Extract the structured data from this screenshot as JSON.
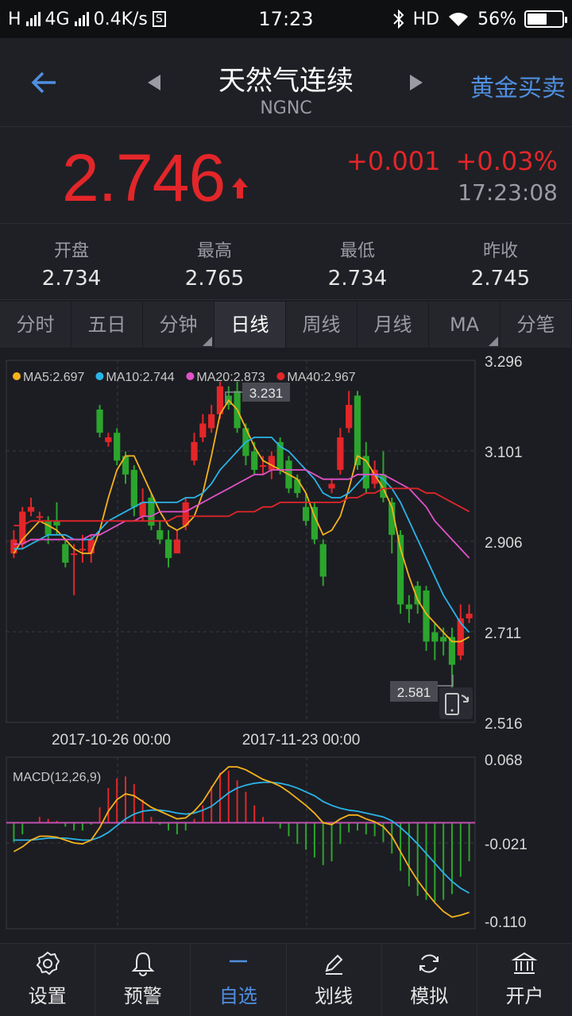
{
  "status_bar": {
    "carrier": "H",
    "network": "4G",
    "speed": "0.4K/s",
    "s_badge": "S",
    "time": "17:23",
    "bluetooth_icon": "bluetooth-icon",
    "hd": "HD",
    "wifi_icon": "wifi-icon",
    "battery": "56%",
    "battery_level": 0.56
  },
  "header": {
    "title": "天然气连续",
    "code": "NGNC",
    "right_link": "黄金买卖"
  },
  "quote": {
    "price": "2.746",
    "change": "+0.001",
    "change_pct": "+0.03%",
    "time": "17:23:08"
  },
  "stats": [
    {
      "label": "开盘",
      "value": "2.734"
    },
    {
      "label": "最高",
      "value": "2.765"
    },
    {
      "label": "最低",
      "value": "2.734"
    },
    {
      "label": "昨收",
      "value": "2.745"
    }
  ],
  "tabs": [
    {
      "label": "分时",
      "active": false,
      "dropdown": false
    },
    {
      "label": "五日",
      "active": false,
      "dropdown": false
    },
    {
      "label": "分钟",
      "active": false,
      "dropdown": true
    },
    {
      "label": "日线",
      "active": true,
      "dropdown": false
    },
    {
      "label": "周线",
      "active": false,
      "dropdown": false
    },
    {
      "label": "月线",
      "active": false,
      "dropdown": false
    },
    {
      "label": "MA",
      "active": false,
      "dropdown": true
    },
    {
      "label": "分笔",
      "active": false,
      "dropdown": false
    }
  ],
  "chart_data": [
    {
      "type": "candlestick",
      "ma_legend": [
        {
          "label": "MA5:2.697",
          "color": "#f5b21c"
        },
        {
          "label": "MA10:2.744",
          "color": "#2ab4e8"
        },
        {
          "label": "MA20:2.873",
          "color": "#e052c8"
        },
        {
          "label": "MA40:2.967",
          "color": "#e3262a"
        }
      ],
      "y_ticks": [
        "3.296",
        "3.101",
        "2.906",
        "2.711",
        "2.516"
      ],
      "ylim": [
        2.516,
        3.296
      ],
      "x_ticks": [
        "2017-10-26 00:00",
        "2017-11-23 00:00"
      ],
      "max_label": "3.231",
      "min_label": "2.581",
      "candles": [
        {
          "o": 2.88,
          "c": 2.91,
          "h": 2.93,
          "l": 2.87
        },
        {
          "o": 2.9,
          "c": 2.97,
          "h": 2.98,
          "l": 2.89
        },
        {
          "o": 2.97,
          "c": 2.98,
          "h": 3.0,
          "l": 2.96
        },
        {
          "o": 2.96,
          "c": 2.96,
          "h": 2.97,
          "l": 2.95
        },
        {
          "o": 2.95,
          "c": 2.92,
          "h": 2.96,
          "l": 2.9
        },
        {
          "o": 2.95,
          "c": 2.94,
          "h": 2.99,
          "l": 2.92
        },
        {
          "o": 2.9,
          "c": 2.86,
          "h": 2.91,
          "l": 2.85
        },
        {
          "o": 2.88,
          "c": 2.88,
          "h": 2.9,
          "l": 2.79
        },
        {
          "o": 2.89,
          "c": 2.89,
          "h": 2.92,
          "l": 2.86
        },
        {
          "o": 2.88,
          "c": 2.91,
          "h": 2.92,
          "l": 2.86
        },
        {
          "o": 3.19,
          "c": 3.14,
          "h": 3.2,
          "l": 3.13
        },
        {
          "o": 3.12,
          "c": 3.13,
          "h": 3.14,
          "l": 3.11
        },
        {
          "o": 3.14,
          "c": 3.08,
          "h": 3.15,
          "l": 3.07
        },
        {
          "o": 3.09,
          "c": 3.05,
          "h": 3.1,
          "l": 3.03
        },
        {
          "o": 3.06,
          "c": 2.98,
          "h": 3.07,
          "l": 2.96
        },
        {
          "o": 2.96,
          "c": 2.99,
          "h": 3.02,
          "l": 2.95
        },
        {
          "o": 3.0,
          "c": 2.94,
          "h": 3.01,
          "l": 2.93
        },
        {
          "o": 2.93,
          "c": 2.91,
          "h": 2.95,
          "l": 2.9
        },
        {
          "o": 2.91,
          "c": 2.87,
          "h": 2.93,
          "l": 2.85
        },
        {
          "o": 2.88,
          "c": 2.91,
          "h": 2.93,
          "l": 2.89
        },
        {
          "o": 2.94,
          "c": 2.99,
          "h": 3.0,
          "l": 2.93
        },
        {
          "o": 3.08,
          "c": 3.12,
          "h": 3.14,
          "l": 3.07
        },
        {
          "o": 3.13,
          "c": 3.16,
          "h": 3.18,
          "l": 3.12
        },
        {
          "o": 3.15,
          "c": 3.18,
          "h": 3.2,
          "l": 3.14
        },
        {
          "o": 3.18,
          "c": 3.24,
          "h": 3.25,
          "l": 3.17
        },
        {
          "o": 3.22,
          "c": 3.2,
          "h": 3.24,
          "l": 3.19
        },
        {
          "o": 3.23,
          "c": 3.15,
          "h": 3.25,
          "l": 3.14
        },
        {
          "o": 3.15,
          "c": 3.09,
          "h": 3.16,
          "l": 3.07
        },
        {
          "o": 3.1,
          "c": 3.06,
          "h": 3.12,
          "l": 3.05
        },
        {
          "o": 3.07,
          "c": 3.07,
          "h": 3.09,
          "l": 3.05
        },
        {
          "o": 3.06,
          "c": 3.09,
          "h": 3.1,
          "l": 3.04
        },
        {
          "o": 3.12,
          "c": 3.06,
          "h": 3.13,
          "l": 3.05
        },
        {
          "o": 3.08,
          "c": 3.02,
          "h": 3.09,
          "l": 3.01
        },
        {
          "o": 3.04,
          "c": 3.01,
          "h": 3.05,
          "l": 3.0
        },
        {
          "o": 2.98,
          "c": 2.95,
          "h": 3.01,
          "l": 2.94
        },
        {
          "o": 2.98,
          "c": 2.91,
          "h": 2.99,
          "l": 2.9
        },
        {
          "o": 2.9,
          "c": 2.83,
          "h": 2.91,
          "l": 2.81
        },
        {
          "o": 3.02,
          "c": 3.03,
          "h": 3.04,
          "l": 3.01
        },
        {
          "o": 3.06,
          "c": 3.13,
          "h": 3.15,
          "l": 3.05
        },
        {
          "o": 3.15,
          "c": 3.2,
          "h": 3.23,
          "l": 3.14
        },
        {
          "o": 3.22,
          "c": 3.07,
          "h": 3.23,
          "l": 3.06
        },
        {
          "o": 3.09,
          "c": 3.02,
          "h": 3.12,
          "l": 3.01
        },
        {
          "o": 3.03,
          "c": 3.06,
          "h": 3.08,
          "l": 3.02
        },
        {
          "o": 3.05,
          "c": 3.0,
          "h": 3.1,
          "l": 2.99
        },
        {
          "o": 2.99,
          "c": 2.92,
          "h": 3.0,
          "l": 2.88
        },
        {
          "o": 2.92,
          "c": 2.77,
          "h": 2.93,
          "l": 2.75
        },
        {
          "o": 2.77,
          "c": 2.76,
          "h": 2.79,
          "l": 2.73
        },
        {
          "o": 2.81,
          "c": 2.77,
          "h": 2.82,
          "l": 2.75
        },
        {
          "o": 2.8,
          "c": 2.69,
          "h": 2.81,
          "l": 2.67
        },
        {
          "o": 2.71,
          "c": 2.69,
          "h": 2.73,
          "l": 2.65
        },
        {
          "o": 2.7,
          "c": 2.69,
          "h": 2.72,
          "l": 2.66
        },
        {
          "o": 2.7,
          "c": 2.64,
          "h": 2.72,
          "l": 2.58
        },
        {
          "o": 2.66,
          "c": 2.74,
          "h": 2.77,
          "l": 2.65
        },
        {
          "o": 2.74,
          "c": 2.75,
          "h": 2.77,
          "l": 2.73
        }
      ],
      "ma_series": [
        {
          "name": "MA5",
          "color": "#f5b21c",
          "values": [
            2.88,
            2.91,
            2.93,
            2.95,
            2.94,
            2.93,
            2.91,
            2.89,
            2.88,
            2.88,
            2.93,
            3.0,
            3.06,
            3.09,
            3.09,
            3.05,
            3.01,
            2.97,
            2.94,
            2.93,
            2.94,
            2.96,
            3.01,
            3.09,
            3.18,
            3.21,
            3.19,
            3.15,
            3.11,
            3.08,
            3.07,
            3.06,
            3.05,
            3.04,
            3.01,
            2.96,
            2.92,
            2.93,
            2.96,
            3.02,
            3.09,
            3.08,
            3.05,
            3.02,
            2.98,
            2.89,
            2.83,
            2.78,
            2.75,
            2.73,
            2.71,
            2.69,
            2.69,
            2.7
          ]
        },
        {
          "name": "MA10",
          "color": "#2ab4e8",
          "values": [
            2.89,
            2.89,
            2.9,
            2.91,
            2.92,
            2.92,
            2.92,
            2.91,
            2.91,
            2.91,
            2.93,
            2.95,
            2.96,
            2.97,
            2.98,
            2.99,
            2.99,
            2.99,
            2.99,
            2.99,
            3.0,
            3.0,
            3.01,
            3.03,
            3.06,
            3.08,
            3.1,
            3.12,
            3.13,
            3.13,
            3.13,
            3.11,
            3.1,
            3.08,
            3.06,
            3.04,
            3.01,
            3.0,
            3.0,
            3.01,
            3.03,
            3.05,
            3.05,
            3.04,
            3.02,
            2.99,
            2.95,
            2.91,
            2.87,
            2.83,
            2.79,
            2.76,
            2.73,
            2.71
          ]
        },
        {
          "name": "MA20",
          "color": "#e052c8",
          "values": [
            2.9,
            2.9,
            2.91,
            2.91,
            2.91,
            2.91,
            2.91,
            2.91,
            2.91,
            2.92,
            2.92,
            2.93,
            2.94,
            2.95,
            2.95,
            2.96,
            2.96,
            2.97,
            2.97,
            2.97,
            2.97,
            2.98,
            2.99,
            3.0,
            3.01,
            3.02,
            3.03,
            3.04,
            3.05,
            3.05,
            3.06,
            3.06,
            3.06,
            3.06,
            3.06,
            3.05,
            3.04,
            3.04,
            3.04,
            3.04,
            3.05,
            3.05,
            3.05,
            3.05,
            3.04,
            3.03,
            3.02,
            3.0,
            2.98,
            2.95,
            2.93,
            2.91,
            2.89,
            2.87
          ]
        },
        {
          "name": "MA40",
          "color": "#e3262a",
          "values": [
            2.94,
            2.94,
            2.95,
            2.95,
            2.95,
            2.95,
            2.95,
            2.95,
            2.95,
            2.95,
            2.95,
            2.95,
            2.95,
            2.95,
            2.95,
            2.95,
            2.95,
            2.95,
            2.95,
            2.96,
            2.96,
            2.96,
            2.96,
            2.96,
            2.96,
            2.96,
            2.97,
            2.97,
            2.97,
            2.98,
            2.98,
            2.99,
            2.99,
            2.99,
            2.99,
            2.99,
            2.99,
            2.99,
            2.99,
            3.0,
            3.0,
            3.01,
            3.01,
            3.02,
            3.02,
            3.02,
            3.02,
            3.02,
            3.01,
            3.01,
            3.0,
            2.99,
            2.98,
            2.97
          ]
        }
      ]
    },
    {
      "type": "macd",
      "label": "MACD(12,26,9)",
      "y_ticks": [
        "0.068",
        "-0.021",
        "-0.110"
      ],
      "ylim": [
        -0.11,
        0.068
      ],
      "dif": [
        -0.03,
        -0.025,
        -0.018,
        -0.014,
        -0.014,
        -0.015,
        -0.018,
        -0.021,
        -0.022,
        -0.018,
        -0.005,
        0.012,
        0.024,
        0.03,
        0.028,
        0.022,
        0.016,
        0.012,
        0.008,
        0.004,
        0.005,
        0.012,
        0.022,
        0.036,
        0.05,
        0.058,
        0.058,
        0.055,
        0.05,
        0.045,
        0.042,
        0.038,
        0.032,
        0.025,
        0.018,
        0.01,
        0.0,
        -0.002,
        0.004,
        0.008,
        0.008,
        0.004,
        0.001,
        -0.004,
        -0.014,
        -0.03,
        -0.046,
        -0.06,
        -0.072,
        -0.083,
        -0.092,
        -0.098,
        -0.096,
        -0.093
      ],
      "dea": [
        -0.018,
        -0.018,
        -0.018,
        -0.017,
        -0.016,
        -0.016,
        -0.016,
        -0.017,
        -0.018,
        -0.018,
        -0.015,
        -0.01,
        -0.003,
        0.004,
        0.009,
        0.012,
        0.013,
        0.013,
        0.012,
        0.01,
        0.009,
        0.01,
        0.013,
        0.017,
        0.024,
        0.031,
        0.036,
        0.039,
        0.041,
        0.042,
        0.042,
        0.041,
        0.039,
        0.036,
        0.032,
        0.028,
        0.022,
        0.018,
        0.015,
        0.013,
        0.012,
        0.01,
        0.008,
        0.006,
        0.002,
        -0.005,
        -0.013,
        -0.022,
        -0.032,
        -0.042,
        -0.052,
        -0.061,
        -0.068,
        -0.073
      ],
      "hist": [
        -0.02,
        -0.012,
        0.0,
        0.006,
        0.004,
        0.002,
        -0.004,
        -0.008,
        -0.008,
        -0.002,
        0.016,
        0.036,
        0.046,
        0.048,
        0.04,
        0.024,
        0.006,
        -0.002,
        -0.008,
        -0.012,
        -0.008,
        0.004,
        0.018,
        0.038,
        0.052,
        0.054,
        0.044,
        0.032,
        0.018,
        0.006,
        0.0,
        -0.006,
        -0.014,
        -0.022,
        -0.028,
        -0.036,
        -0.044,
        -0.04,
        -0.022,
        -0.01,
        -0.008,
        -0.012,
        -0.014,
        -0.02,
        -0.032,
        -0.05,
        -0.066,
        -0.076,
        -0.08,
        -0.082,
        -0.08,
        -0.074,
        -0.056,
        -0.04
      ]
    }
  ],
  "chart_controls": {
    "fullscreen_icon": "fullscreen-toggle-icon"
  },
  "bottom_nav": [
    {
      "label": "设置",
      "icon": "settings-icon",
      "active": false
    },
    {
      "label": "预警",
      "icon": "bell-icon",
      "active": false
    },
    {
      "label": "自选",
      "icon": "minus-icon",
      "active": true
    },
    {
      "label": "划线",
      "icon": "pen-icon",
      "active": false
    },
    {
      "label": "模拟",
      "icon": "refresh-icon",
      "active": false
    },
    {
      "label": "开户",
      "icon": "bank-icon",
      "active": false
    }
  ],
  "colors": {
    "up": "#e3262a",
    "down": "#2ba52e",
    "accent": "#4f8fe0",
    "background": "#1c1d22"
  }
}
